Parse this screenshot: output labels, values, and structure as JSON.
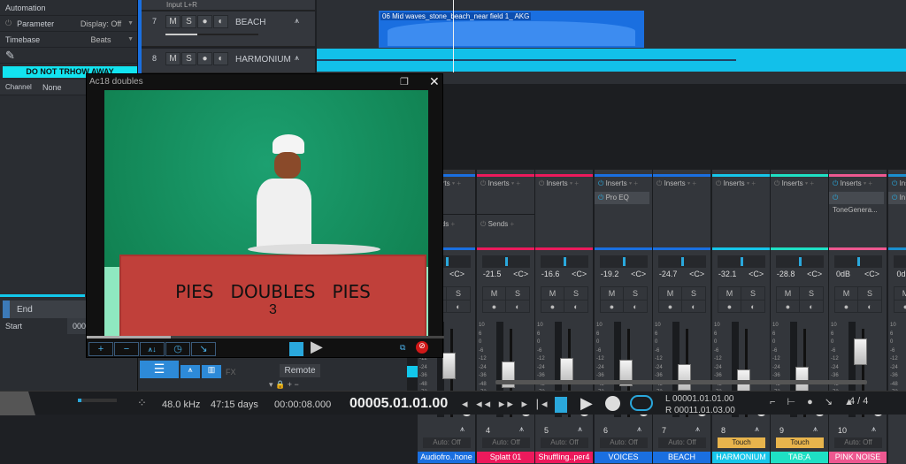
{
  "inspector": {
    "automation": "Automation",
    "parameter": "Parameter",
    "parameter_value": "Display: Off",
    "timebase": "Timebase",
    "timebase_value": "Beats",
    "warning": "DO NOT TRHOW AWAY",
    "channel": "Channel",
    "channel_value": "None",
    "end": "End",
    "start": "Start",
    "start_value": "000"
  },
  "tracks": [
    {
      "num": "7",
      "name": "BEACH",
      "color": "#1a6fe0"
    },
    {
      "num": "8",
      "name": "HARMONIUM",
      "color": "#12c8ec"
    }
  ],
  "track_buttons": {
    "mute": "M",
    "solo": "S"
  },
  "timeline": {
    "input": "Input L+R",
    "clip_name": "06 Mid waves_stone_beach_near field 1_ AKG"
  },
  "video": {
    "title": "Ac18 doubles",
    "sign": "PIES   DOUBLES   PIES",
    "sign2": "3"
  },
  "mixer": {
    "inserts": "Inserts",
    "sends": "Sends",
    "pan": "<C>",
    "mute": "M",
    "solo": "S",
    "scale": [
      "10",
      "6",
      "0",
      "-6",
      "-12",
      "-24",
      "-36",
      "-48",
      "-72"
    ],
    "channels": [
      {
        "num": "",
        "name": "Audiofro..hone",
        "color": "#1a6fe0",
        "vol": "",
        "db": -10,
        "auto": "Auto: Off",
        "insert": "",
        "sends": true
      },
      {
        "num": "4",
        "name": "Splatt 01",
        "color": "#ec1a5c",
        "vol": "-21.5",
        "db": -21.5,
        "auto": "Auto: Off",
        "insert": "",
        "sends": true
      },
      {
        "num": "5",
        "name": "Shuffling..per4",
        "color": "#ec1a5c",
        "vol": "-16.6",
        "db": -16.6,
        "auto": "Auto: Off",
        "insert": ""
      },
      {
        "num": "6",
        "name": "VOICES",
        "color": "#1a6fe0",
        "vol": "-19.2",
        "db": -19.2,
        "auto": "Auto: Off",
        "insert": "Pro EQ"
      },
      {
        "num": "7",
        "name": "BEACH",
        "color": "#1a6fe0",
        "vol": "-24.7",
        "db": -24.7,
        "auto": "Auto: Off",
        "insert": ""
      },
      {
        "num": "8",
        "name": "HARMONIUM",
        "color": "#16c6ea",
        "vol": "-32.1",
        "db": -32.1,
        "auto": "Touch",
        "insert": ""
      },
      {
        "num": "9",
        "name": "TAB;A",
        "color": "#1ee0c4",
        "vol": "-28.8",
        "db": -28.8,
        "auto": "Touch",
        "insert": ""
      },
      {
        "num": "10",
        "name": "PINK NOISE",
        "color": "#ee5890",
        "vol": "0dB",
        "db": 0,
        "auto": "Auto: Off",
        "insert": "ToneGenera..."
      },
      {
        "num": "",
        "name": "",
        "color": "#1a8fd0",
        "vol": "0d",
        "db": 0,
        "auto": "",
        "insert": "In"
      }
    ]
  },
  "console_nav": {
    "fx": "FX",
    "remote": "Remote"
  },
  "transport": {
    "sample_rate": "48.0 kHz",
    "record_time": "47:15 days",
    "seconds": "00:00:08.000",
    "position": "00005.01.01.00",
    "loop_left": "L  00001.01.01.00",
    "loop_right": "R  00011.01.03.00",
    "signature": "4 / 4"
  }
}
